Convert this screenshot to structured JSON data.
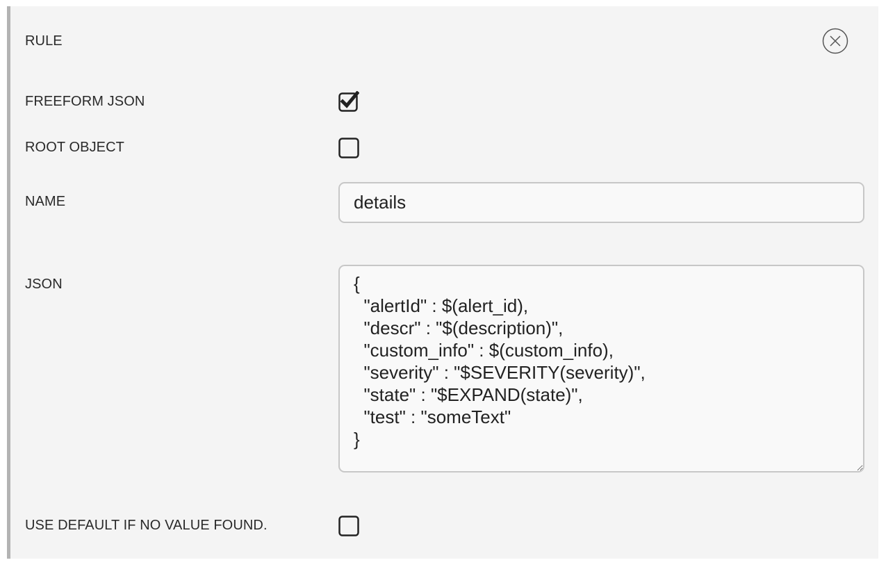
{
  "rule": {
    "title": "RULE",
    "close_icon": "circle-x-icon"
  },
  "fields": {
    "freeform_json": {
      "label": "FREEFORM JSON",
      "checked": true
    },
    "root_object": {
      "label": "ROOT OBJECT",
      "checked": false
    },
    "name": {
      "label": "NAME",
      "value": "details"
    },
    "json": {
      "label": "JSON",
      "value": "{\n  \"alertId\" : $(alert_id),\n  \"descr\" : \"$(description)\",\n  \"custom_info\" : $(custom_info),\n  \"severity\" : \"$SEVERITY(severity)\",\n  \"state\" : \"$EXPAND(state)\",\n  \"test\" : \"someText\"\n}"
    },
    "use_default": {
      "label": "USE DEFAULT IF NO VALUE FOUND.",
      "checked": false
    }
  },
  "colors": {
    "panel_bg": "#f4f4f4",
    "accent_border": "#b3b3b3",
    "input_border": "#c7c7c7",
    "text": "#222222"
  }
}
